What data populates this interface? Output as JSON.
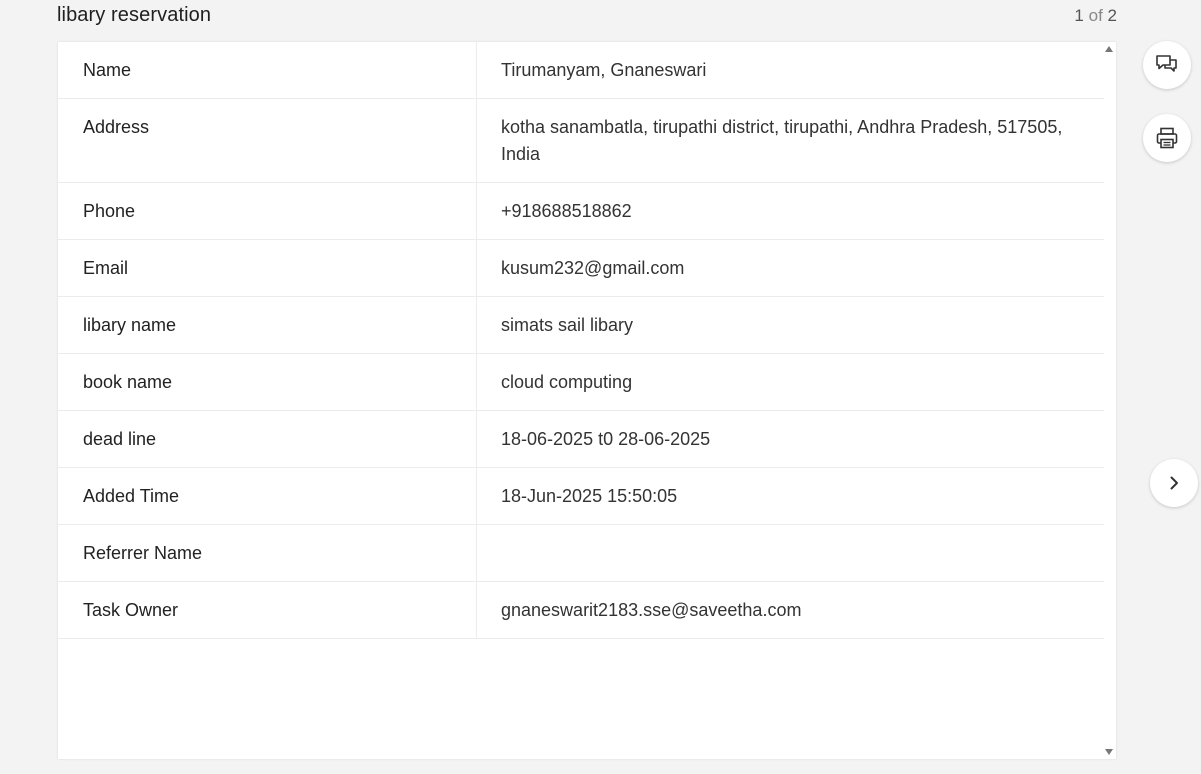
{
  "header": {
    "title": "libary reservation",
    "pager_current": "1",
    "pager_sep": "of",
    "pager_total": "2"
  },
  "record": {
    "rows": [
      {
        "label": "Name",
        "value": "Tirumanyam, Gnaneswari",
        "is_link": false
      },
      {
        "label": "Address",
        "value": "kotha sanambatla, tirupathi district, tirupathi, Andhra Pradesh, 517505, India",
        "is_link": false
      },
      {
        "label": "Phone",
        "value": "+918688518862",
        "is_link": true
      },
      {
        "label": "Email",
        "value": "kusum232@gmail.com",
        "is_link": true
      },
      {
        "label": "libary name",
        "value": "simats sail libary",
        "is_link": false
      },
      {
        "label": "book name",
        "value": "cloud computing",
        "is_link": false
      },
      {
        "label": "dead line",
        "value": "18-06-2025 t0 28-06-2025",
        "is_link": false
      },
      {
        "label": "Added Time",
        "value": "18-Jun-2025 15:50:05",
        "is_link": false
      },
      {
        "label": "Referrer Name",
        "value": "",
        "is_link": false
      },
      {
        "label": "Task Owner",
        "value": "gnaneswarit2183.sse@saveetha.com",
        "is_link": true
      }
    ]
  },
  "actions": {
    "comments_icon": "comments-icon",
    "print_icon": "print-icon",
    "next_icon": "chevron-right-icon"
  },
  "colors": {
    "link": "#1f9e82",
    "background": "#f3f3f3"
  }
}
